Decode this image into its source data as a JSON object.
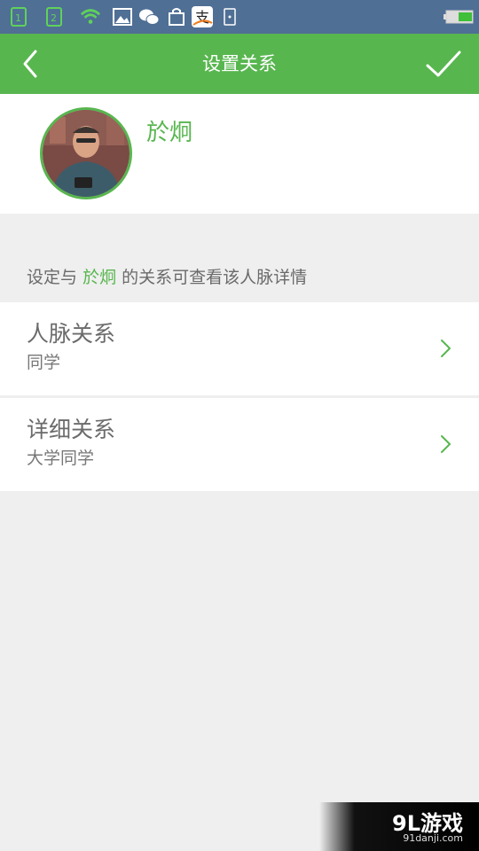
{
  "status_bar": {
    "icons": [
      "sim1-icon",
      "sim2-icon",
      "wifi-icon",
      "gallery-icon",
      "wechat-icon",
      "shopping-bag-icon",
      "alipay-icon",
      "phone-icon",
      "battery-icon"
    ]
  },
  "header": {
    "title": "设置关系",
    "back_icon": "chevron-left-icon",
    "confirm_icon": "checkmark-icon"
  },
  "profile": {
    "name": "於炯"
  },
  "hint": {
    "prefix": "设定与",
    "name": "於炯",
    "suffix": "的关系可查看该人脉详情"
  },
  "relations": [
    {
      "title": "人脉关系",
      "value": "同学"
    },
    {
      "title": "详细关系",
      "value": "大学同学"
    }
  ],
  "watermark": {
    "logo": "9L游戏",
    "url": "91danji.com"
  },
  "colors": {
    "accent": "#58b64f",
    "status_bar": "#4f6f95",
    "background": "#efefef"
  }
}
